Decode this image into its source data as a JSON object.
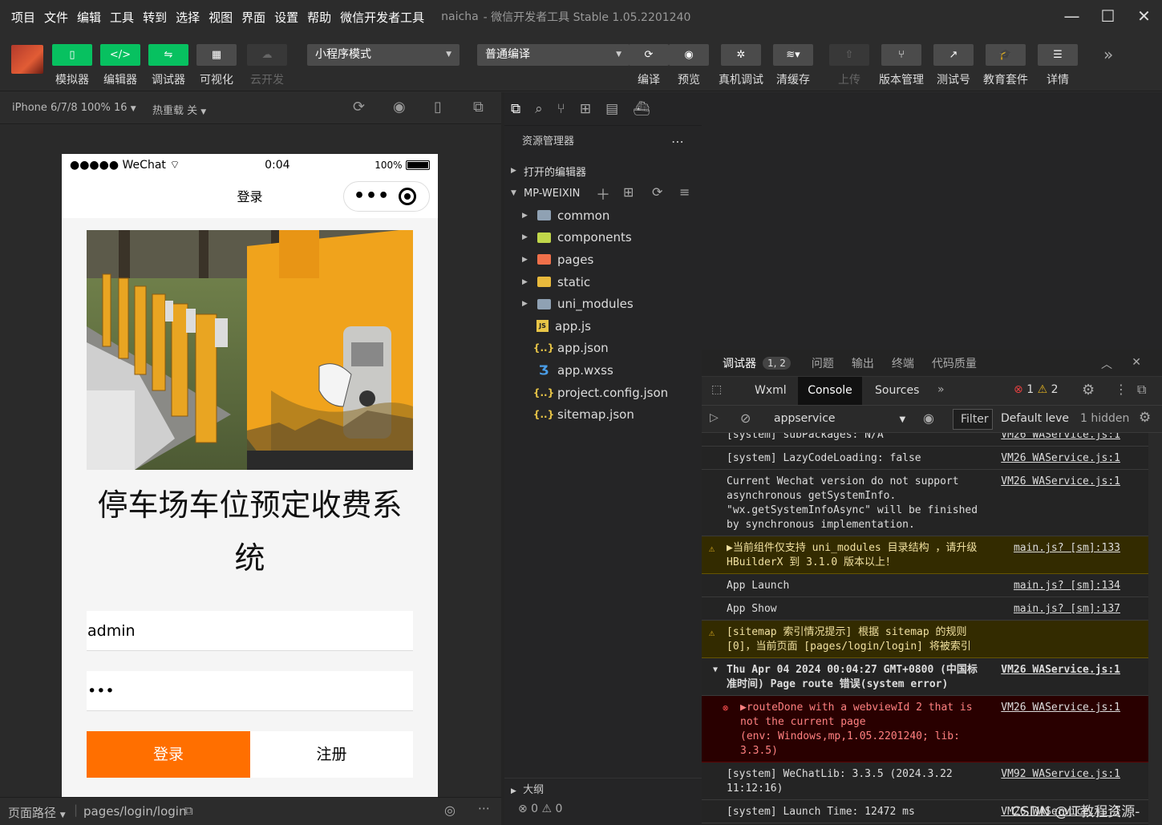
{
  "menu": {
    "items": [
      "项目",
      "文件",
      "编辑",
      "工具",
      "转到",
      "选择",
      "视图",
      "界面",
      "设置",
      "帮助",
      "微信开发者工具"
    ],
    "project": "naicha",
    "app_title": "- 微信开发者工具 Stable 1.05.2201240"
  },
  "toolbar": {
    "simulator": "模拟器",
    "editor": "编辑器",
    "debugger": "调试器",
    "visual": "可视化",
    "cloud": "云开发",
    "mode_select": "小程序模式",
    "compile_select": "普通编译",
    "compile": "编译",
    "preview": "预览",
    "device_debug": "真机调试",
    "clear_cache": "清缓存",
    "upload": "上传",
    "version": "版本管理",
    "test_account": "测试号",
    "edu": "教育套件",
    "details": "详情"
  },
  "simulator": {
    "device": "iPhone 6/7/8 100% 16",
    "hot_reload": "热重载 关",
    "status": {
      "carrier": "●●●●● WeChat",
      "time": "0:04",
      "battery": "100%"
    },
    "nav_title": "登录",
    "app_title": "停车场车位预定收费系统",
    "username_value": "admin",
    "password_value": "•••",
    "login_button": "登录",
    "register_button": "注册"
  },
  "bottom": {
    "path_label": "页面路径",
    "path": "pages/login/login"
  },
  "explorer": {
    "title": "资源管理器",
    "open_editors": "打开的编辑器",
    "project": "MP-WEIXIN",
    "tree": [
      {
        "name": "common",
        "type": "folder",
        "color": "#8fa1b3"
      },
      {
        "name": "components",
        "type": "folder",
        "color": "#c0d64a"
      },
      {
        "name": "pages",
        "type": "folder",
        "color": "#f0704a"
      },
      {
        "name": "static",
        "type": "folder",
        "color": "#e8b93c"
      },
      {
        "name": "uni_modules",
        "type": "folder",
        "color": "#8fa1b3"
      },
      {
        "name": "app.js",
        "type": "js",
        "color": "#e8c547"
      },
      {
        "name": "app.json",
        "type": "json",
        "color": "#e8c547"
      },
      {
        "name": "app.wxss",
        "type": "wxss",
        "color": "#4a9ee8"
      },
      {
        "name": "project.config.json",
        "type": "json",
        "color": "#e8c547"
      },
      {
        "name": "sitemap.json",
        "type": "json",
        "color": "#e8c547"
      }
    ],
    "outline": "大纲",
    "problems": "⊗ 0 ⚠ 0"
  },
  "debugger": {
    "tabs": [
      "调试器",
      "问题",
      "输出",
      "终端",
      "代码质量"
    ],
    "badge": "1, 2",
    "dev_tabs": [
      "Wxml",
      "Console",
      "Sources"
    ],
    "error_count": "1",
    "warn_count": "2",
    "context": "appservice",
    "filter_placeholder": "Filter",
    "level": "Default leve",
    "hidden": "1 hidden",
    "logs": [
      {
        "kind": "info",
        "text": "[system] subPackages: N/A",
        "src": "VM26 WAService.js:1"
      },
      {
        "kind": "info",
        "text": "[system] LazyCodeLoading: false",
        "src": "VM26 WAService.js:1"
      },
      {
        "kind": "info",
        "text": "Current Wechat version do not support asynchronous getSystemInfo. \"wx.getSystemInfoAsync\" will be finished by synchronous implementation.",
        "src": "VM26 WAService.js:1"
      },
      {
        "kind": "warn",
        "text": "▶当前组件仅支持 uni_modules 目录结构 ，请升级 HBuilderX 到 3.1.0 版本以上！",
        "src": "main.js? [sm]:133"
      },
      {
        "kind": "info",
        "text": "App Launch",
        "src": "main.js? [sm]:134"
      },
      {
        "kind": "info",
        "text": "App Show",
        "src": "main.js? [sm]:137"
      },
      {
        "kind": "warn",
        "text": "[sitemap 索引情况提示] 根据 sitemap 的规则[0]，当前页面 [pages/login/login] 将被索引",
        "src": ""
      },
      {
        "kind": "group",
        "text": "Thu Apr 04 2024 00:04:27 GMT+0800 (中国标准时间) Page route 错误(system error)",
        "src": "VM26 WAService.js:1"
      },
      {
        "kind": "err",
        "text": "▶routeDone with a webviewId 2 that is not the current page\n(env: Windows,mp,1.05.2201240; lib: 3.3.5)",
        "src": "VM26 WAService.js:1"
      },
      {
        "kind": "info",
        "text": "[system] WeChatLib: 3.3.5 (2024.3.22 11:12:16)",
        "src": "VM92 WAService.js:1"
      },
      {
        "kind": "info",
        "text": "[system] Launch Time: 12472 ms",
        "src": "VM26 WAService.js:1"
      }
    ],
    "prompt": "›"
  },
  "watermark": "CSDN @IT教程资源-"
}
